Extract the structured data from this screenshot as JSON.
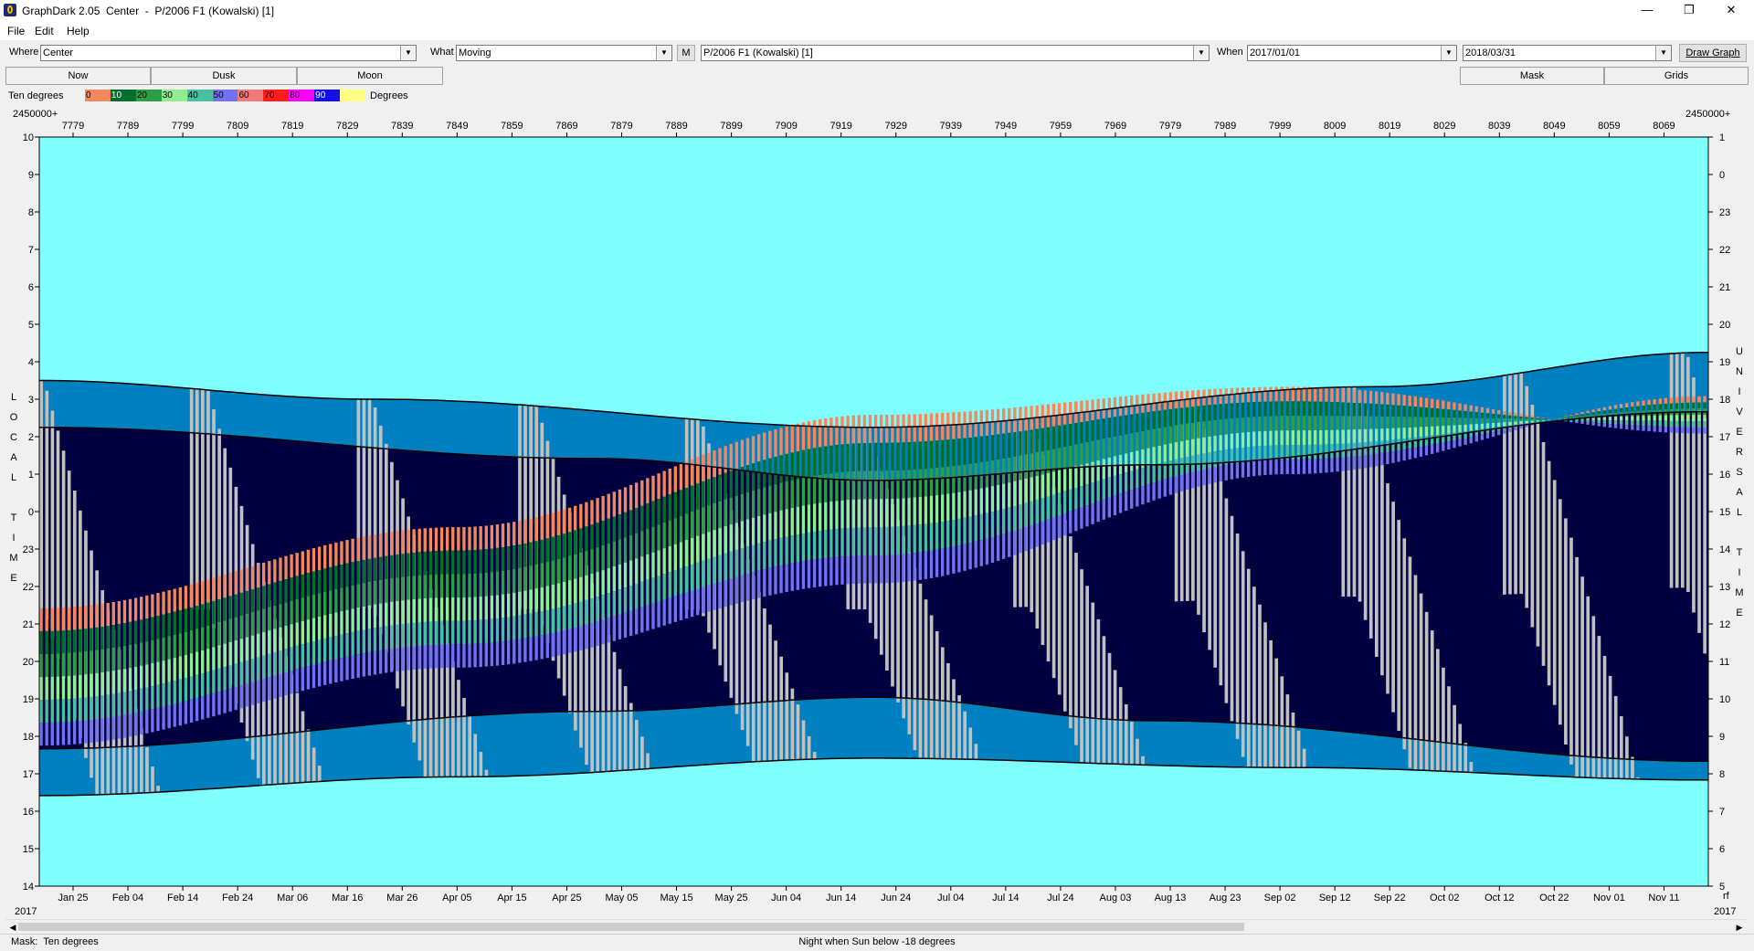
{
  "window": {
    "title": "GraphDark 2.05  Center  -  P/2006 F1 (Kowalski) [1]",
    "minimize_glyph": "—",
    "restore_glyph": "❐",
    "close_glyph": "✕"
  },
  "menu": {
    "items": [
      "File",
      "Edit",
      "Help"
    ]
  },
  "toolbar": {
    "where_label": "Where",
    "where_value": "Center",
    "what_label": "What",
    "what_value": "Moving",
    "m_button": "M",
    "object_value": "P/2006 F1 (Kowalski) [1]",
    "when_label": "When",
    "start_date": "2017/01/01",
    "end_date": "2018/03/31",
    "draw_button": "Draw Graph"
  },
  "tabs": {
    "now": "Now",
    "dusk": "Dusk",
    "moon": "Moon",
    "mask": "Mask",
    "grids": "Grids"
  },
  "legend": {
    "title": "Ten degrees",
    "unit": "Degrees",
    "labels": [
      "0",
      "10",
      "20",
      "30",
      "40",
      "50",
      "60",
      "70",
      "80",
      "90"
    ],
    "colors": [
      "#f4885c",
      "#006f2e",
      "#2e9e44",
      "#90ee90",
      "#48bfa0",
      "#7272f0",
      "#f07a7a",
      "#ff1d1d",
      "#ff00ff",
      "#1212e8",
      "#ffff80"
    ]
  },
  "chart_data": {
    "type": "heatmap",
    "jd_offset_label": "2450000+",
    "jd_ticks": [
      7779,
      7789,
      7799,
      7809,
      7819,
      7829,
      7839,
      7849,
      7859,
      7869,
      7879,
      7889,
      7899,
      7909,
      7919,
      7929,
      7939,
      7949,
      7959,
      7969,
      7979,
      7989,
      7999,
      8009,
      8019,
      8029,
      8039,
      8049,
      8059,
      8069
    ],
    "date_ticks": [
      "Jan 25",
      "Feb 04",
      "Feb 14",
      "Feb 24",
      "Mar 06",
      "Mar 16",
      "Mar 26",
      "Apr 05",
      "Apr 15",
      "Apr 25",
      "May 05",
      "May 15",
      "May 25",
      "Jun 04",
      "Jun 14",
      "Jun 24",
      "Jul 04",
      "Jul 14",
      "Jul 24",
      "Aug 03",
      "Aug 13",
      "Aug 23",
      "Sep 02",
      "Sep 12",
      "Sep 22",
      "Oct 02",
      "Oct 12",
      "Oct 22",
      "Nov 01",
      "Nov 11"
    ],
    "year_left": "2017",
    "year_right": "2017",
    "left_axis_label": [
      "L",
      "O",
      "C",
      "A",
      "L",
      "",
      "T",
      "I",
      "M",
      "E"
    ],
    "right_axis_label": [
      "U",
      "N",
      "I",
      "V",
      "E",
      "R",
      "S",
      "A",
      "L",
      "",
      "T",
      "I",
      "M",
      "E"
    ],
    "left_ticks": [
      "10",
      "9",
      "8",
      "7",
      "6",
      "5",
      "4",
      "3",
      "2",
      "1",
      "0",
      "23",
      "22",
      "21",
      "20",
      "19",
      "18",
      "17",
      "16",
      "15",
      "14"
    ],
    "right_ticks": [
      "1",
      "0",
      "23",
      "22",
      "21",
      "20",
      "19",
      "18",
      "17",
      "16",
      "15",
      "14",
      "13",
      "12",
      "11",
      "10",
      "9",
      "8",
      "7",
      "6",
      "5"
    ],
    "right_edge_mark": "rf",
    "night_start_pts": [
      [
        0,
        19.3
      ],
      [
        0.333,
        20.3
      ],
      [
        0.5,
        21.0
      ],
      [
        0.667,
        20.5
      ],
      [
        1,
        18.8
      ]
    ],
    "night_end_pts": [
      [
        0,
        29.6
      ],
      [
        0.333,
        28.4
      ],
      [
        0.5,
        27.95
      ],
      [
        0.667,
        28.7
      ],
      [
        1,
        30.0
      ]
    ],
    "twilight_start_pts": [
      [
        0,
        17.8
      ],
      [
        0.2,
        18.4
      ],
      [
        0.5,
        19.3
      ],
      [
        0.8,
        18.0
      ],
      [
        1,
        16.9
      ]
    ],
    "twilight_end_pts": [
      [
        0,
        31.1
      ],
      [
        0.25,
        30.5
      ],
      [
        0.5,
        29.9
      ],
      [
        0.75,
        30.2
      ],
      [
        1,
        30.6
      ]
    ],
    "object_band_top_pts": [
      [
        0,
        29.5
      ],
      [
        0.25,
        27.0
      ],
      [
        0.5,
        24.3
      ],
      [
        0.75,
        20.8
      ],
      [
        1,
        18.3
      ]
    ],
    "object_band_bottom_pts": [
      [
        0,
        25.1
      ],
      [
        0.25,
        22.5
      ],
      [
        0.5,
        18.9
      ],
      [
        0.75,
        18.0
      ],
      [
        1,
        19.5
      ]
    ],
    "colors": {
      "sky_day": "#80ffff",
      "twilight": "#0080c0",
      "night": "#000040",
      "moon": "#c0c0c0",
      "grid_line": "#000000"
    }
  },
  "status": {
    "mask": "Mask:  Ten degrees",
    "night_rule": "Night when Sun below -18 degrees"
  }
}
